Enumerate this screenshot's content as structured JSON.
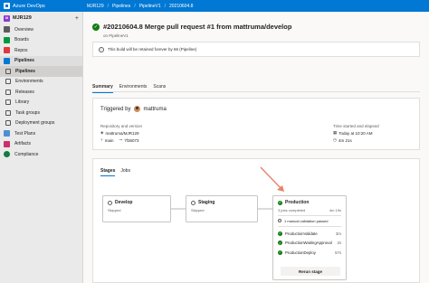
{
  "topbar": {
    "brand": "Azure DevOps",
    "breadcrumbs": [
      "MJR129",
      "Pipelines",
      "PipelineV1",
      "20210604.8"
    ]
  },
  "sidebar": {
    "project_initials": "M",
    "project_name": "MJR129",
    "items": [
      {
        "label": "Overview",
        "icon": "overview-icon"
      },
      {
        "label": "Boards",
        "icon": "boards-icon"
      },
      {
        "label": "Repos",
        "icon": "repos-icon"
      },
      {
        "label": "Pipelines",
        "icon": "pipelines-icon"
      },
      {
        "label": "Pipelines",
        "icon": "pipelines-sub-icon"
      },
      {
        "label": "Environments",
        "icon": "environments-icon"
      },
      {
        "label": "Releases",
        "icon": "releases-icon"
      },
      {
        "label": "Library",
        "icon": "library-icon"
      },
      {
        "label": "Task groups",
        "icon": "task-groups-icon"
      },
      {
        "label": "Deployment groups",
        "icon": "deployment-groups-icon"
      },
      {
        "label": "Test Plans",
        "icon": "test-plans-icon"
      },
      {
        "label": "Artifacts",
        "icon": "artifacts-icon"
      },
      {
        "label": "Compliance",
        "icon": "compliance-icon"
      }
    ]
  },
  "run": {
    "title": "#20210604.8 Merge pull request #1 from mattruma/develop",
    "subtitle": "on PipelineV1",
    "banner": "This build will be retained forever by 66 (Pipeline)"
  },
  "tabs": [
    "Summary",
    "Environments",
    "Scans"
  ],
  "summary": {
    "triggered_by_label": "Triggered by",
    "triggered_by": "mattruma",
    "repo_label": "Repository and version",
    "repo": "mattruma/MJR129",
    "branch": "main",
    "commit": "7f36073",
    "time_label": "Time started and elapsed",
    "started": "Today at 10:20 AM",
    "elapsed": "4m 21s"
  },
  "stages_tabs": [
    "Stages",
    "Jobs"
  ],
  "stages": [
    {
      "name": "Develop",
      "status": "Skipped"
    },
    {
      "name": "Staging",
      "status": "Skipped"
    },
    {
      "name": "Production",
      "jobs_summary": "3 jobs completed",
      "jobs_time": "4m 19s",
      "validation": "1 manual validation passed",
      "jobs": [
        {
          "name": "ProductionValidate",
          "time": "3m"
        },
        {
          "name": "ProductionWaitingApproval",
          "time": "2s"
        },
        {
          "name": "ProductionDeploy",
          "time": "57s"
        }
      ],
      "rerun_label": "Rerun stage"
    }
  ],
  "colors": {
    "accent": "#0078d4",
    "success": "#107c10",
    "arrow": "#e8836a"
  }
}
